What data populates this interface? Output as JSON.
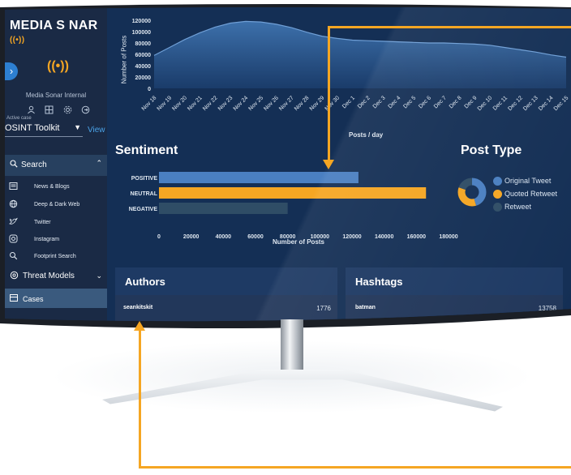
{
  "sidebar": {
    "logo": "MEDIA S NAR",
    "logo_mark": "((•))",
    "toggle": "›",
    "brand_icon": "((•))",
    "org_name": "Media Sonar Internal",
    "active_case_label": "Active case",
    "active_case_value": "OSINT Toolkit",
    "view_link": "View",
    "search_label": "Search",
    "nav_items": [
      {
        "label": "News & Blogs",
        "icon": "newspaper-icon"
      },
      {
        "label": "Deep & Dark Web",
        "icon": "globe-icon"
      },
      {
        "label": "Twitter",
        "icon": "twitter-icon"
      },
      {
        "label": "Instagram",
        "icon": "instagram-icon"
      },
      {
        "label": "Footprint Search",
        "icon": "footprint-search-icon"
      }
    ],
    "threat_models_label": "Threat Models",
    "cases_label": "Cases"
  },
  "posts_chart": {
    "xlabel": "Posts / day",
    "ylabel": "Number of Posts"
  },
  "sentiment": {
    "title": "Sentiment",
    "xlabel": "Number of Posts"
  },
  "post_type": {
    "title": "Post Type",
    "legend": [
      {
        "label": "Original Tweet",
        "color": "#4a7fc1"
      },
      {
        "label": "Quoted Retweet",
        "color": "#f5a623"
      },
      {
        "label": "Retweet",
        "color": "#2f4d66"
      }
    ]
  },
  "authors": {
    "title": "Authors",
    "rows": [
      {
        "name": "seankitskit",
        "count": "1776"
      }
    ]
  },
  "hashtags": {
    "title": "Hashtags",
    "rows": [
      {
        "name": "batman",
        "count": "13758"
      }
    ]
  },
  "colors": {
    "accent": "#f5a623",
    "screen_bg": "#152f52",
    "sidebar_bg": "#1a2a45",
    "bar_positive": "#4a7fc1",
    "bar_neutral": "#f5a623",
    "bar_negative": "#2f4d66"
  },
  "chart_data": [
    {
      "type": "area",
      "ylabel": "Number of Posts",
      "xlabel": "Posts / day",
      "x": [
        "Nov 18",
        "Nov 19",
        "Nov 20",
        "Nov 21",
        "Nov 22",
        "Nov 23",
        "Nov 24",
        "Nov 25",
        "Nov 26",
        "Nov 27",
        "Nov 28",
        "Nov 29",
        "Nov 30",
        "Dec 1",
        "Dec 2",
        "Dec 3",
        "Dec 4",
        "Dec 5",
        "Dec 6",
        "Dec 7",
        "Dec 8",
        "Dec 9",
        "Dec 10",
        "Dec 11",
        "Dec 12",
        "Dec 13",
        "Dec 14",
        "Dec 15"
      ],
      "values": [
        58000,
        72000,
        86000,
        98000,
        108000,
        115000,
        118000,
        117000,
        113000,
        107000,
        99000,
        92000,
        88000,
        85000,
        84000,
        83000,
        82000,
        81000,
        80000,
        80000,
        79000,
        78000,
        76000,
        72000,
        68000,
        64000,
        59000,
        55000
      ],
      "yticks": [
        0,
        20000,
        40000,
        60000,
        80000,
        100000,
        120000
      ],
      "ylim": [
        0,
        120000
      ],
      "grid": false
    },
    {
      "type": "bar",
      "orientation": "horizontal",
      "categories": [
        "POSITIVE",
        "NEUTRAL",
        "NEGATIVE"
      ],
      "values": [
        124000,
        166000,
        80000
      ],
      "xlabel": "Number of Posts",
      "xticks": [
        0,
        20000,
        40000,
        60000,
        80000,
        100000,
        120000,
        140000,
        160000,
        180000
      ],
      "xlim": [
        0,
        180000
      ],
      "grid": false
    },
    {
      "type": "pie",
      "donut": true,
      "categories": [
        "Original Tweet",
        "Quoted Retweet",
        "Retweet"
      ],
      "values": [
        45,
        35,
        20
      ]
    }
  ]
}
